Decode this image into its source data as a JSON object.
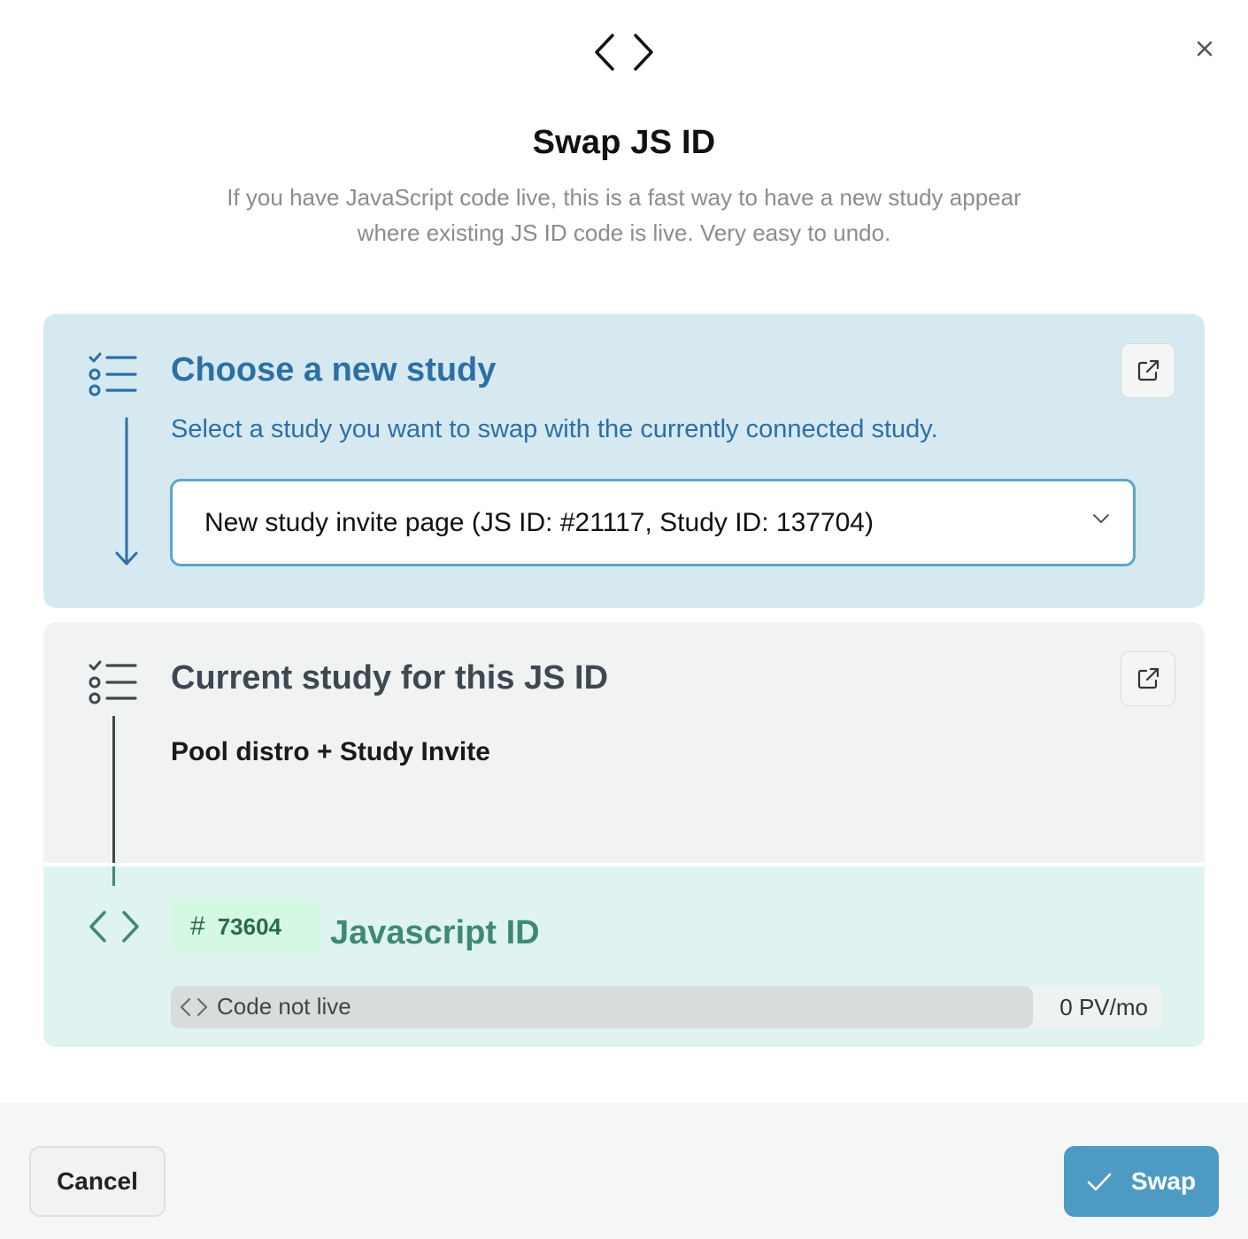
{
  "dialog": {
    "title": "Swap JS ID",
    "subtitle_line1": "If you have JavaScript code live, this is a fast way to have a new study appear",
    "subtitle_line2": "where existing JS ID code is live. Very easy to undo.",
    "header_icon": "code-brackets-icon",
    "close_icon": "close-icon"
  },
  "new_study": {
    "title": "Choose a new study",
    "description": "Select a study you want to swap with the currently connected study.",
    "selected_value": "New study invite page (JS ID: #21117, Study ID: 137704)",
    "icon": "checklist-icon",
    "external_icon": "external-link-icon"
  },
  "current_study": {
    "title": "Current study for this JS ID",
    "value": "Pool distro + Study Invite",
    "icon": "checklist-icon",
    "external_icon": "external-link-icon"
  },
  "javascript": {
    "hash_symbol": "#",
    "id": "73604",
    "title": "Javascript ID",
    "status": "Code not live",
    "pageviews": "0 PV/mo",
    "live_fraction": 0.87
  },
  "footer": {
    "cancel_label": "Cancel",
    "swap_label": "Swap"
  },
  "colors": {
    "new_study_accent": "#2d6fa6",
    "javascript_accent": "#3d8a72",
    "swap_button": "#4d9bc2"
  }
}
